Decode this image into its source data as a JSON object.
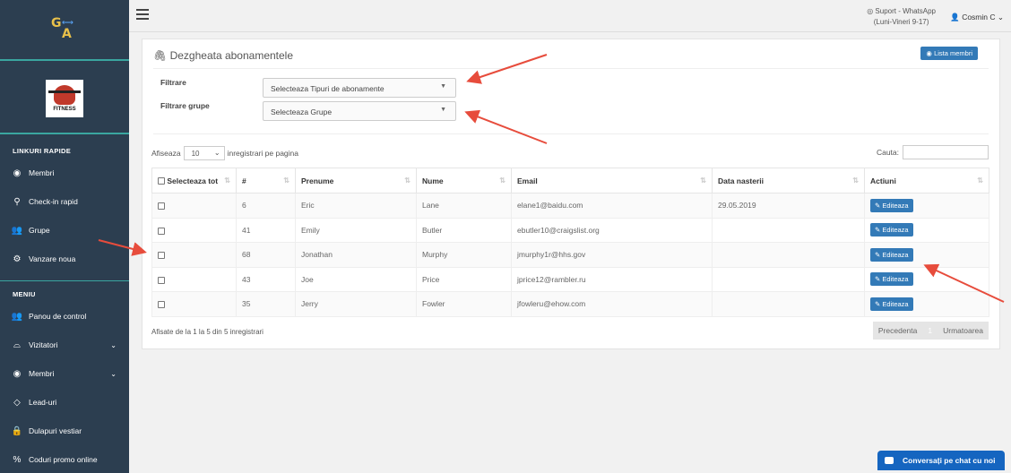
{
  "sidebar": {
    "logo_text_g": "G",
    "logo_text_a": "A",
    "gym_logo_text": "FITNESS",
    "quick_links_title": "LINKURI RAPIDE",
    "quick_links": [
      {
        "label": "Membri",
        "icon": "user-circle-icon"
      },
      {
        "label": "Check-in rapid",
        "icon": "map-marker-icon"
      },
      {
        "label": "Grupe",
        "icon": "users-icon"
      },
      {
        "label": "Vanzare noua",
        "icon": "cog-icon"
      }
    ],
    "menu_title": "MENIU",
    "menu": [
      {
        "label": "Panou de control",
        "icon": "users-icon"
      },
      {
        "label": "Vizitatori",
        "icon": "glasses-icon",
        "chevron": "⌄"
      },
      {
        "label": "Membri",
        "icon": "user-circle-icon",
        "chevron": "⌄"
      },
      {
        "label": "Lead-uri",
        "icon": "diamond-icon"
      },
      {
        "label": "Dulapuri vestiar",
        "icon": "lock-icon"
      },
      {
        "label": "Coduri promo online",
        "icon": "percent-icon"
      }
    ]
  },
  "topbar": {
    "support_line1": "Suport - WhatsApp",
    "support_line2": "(Luni-Vineri 9-17)",
    "user_name": "Cosmin C"
  },
  "panel": {
    "title": "Dezgheata abonamentele",
    "lista_button": "Lista membri",
    "filter_label": "Filtrare",
    "filter_placeholder": "Selecteaza Tipuri de abonamente",
    "group_filter_label": "Filtrare grupe",
    "group_filter_placeholder": "Selecteaza Grupe",
    "show_prefix": "Afiseaza",
    "page_length": "10",
    "show_suffix": "inregistrari pe pagina",
    "search_label": "Cauta:",
    "info": "Afisate de la 1 la 5 din 5 inregistrari",
    "prev": "Precedenta",
    "current_page": "1",
    "next": "Urmatoarea"
  },
  "table": {
    "headers": [
      "Selecteaza tot",
      "#",
      "Prenume",
      "Nume",
      "Email",
      "Data nasterii",
      "Actiuni"
    ],
    "edit_label": "Editeaza",
    "rows": [
      {
        "id": "6",
        "first": "Eric",
        "last": "Lane",
        "email": "elane1@baidu.com",
        "dob": "29.05.2019"
      },
      {
        "id": "41",
        "first": "Emily",
        "last": "Butler",
        "email": "ebutler10@craigslist.org",
        "dob": ""
      },
      {
        "id": "68",
        "first": "Jonathan",
        "last": "Murphy",
        "email": "jmurphy1r@hhs.gov",
        "dob": ""
      },
      {
        "id": "43",
        "first": "Joe",
        "last": "Price",
        "email": "jprice12@rambler.ru",
        "dob": ""
      },
      {
        "id": "35",
        "first": "Jerry",
        "last": "Fowler",
        "email": "jfowleru@ehow.com",
        "dob": ""
      }
    ]
  },
  "chat": {
    "label": "Conversați pe chat cu noi"
  },
  "colors": {
    "sidebar": "#2c3e50",
    "accent": "#337ab7",
    "arrow": "#e74c3c"
  }
}
